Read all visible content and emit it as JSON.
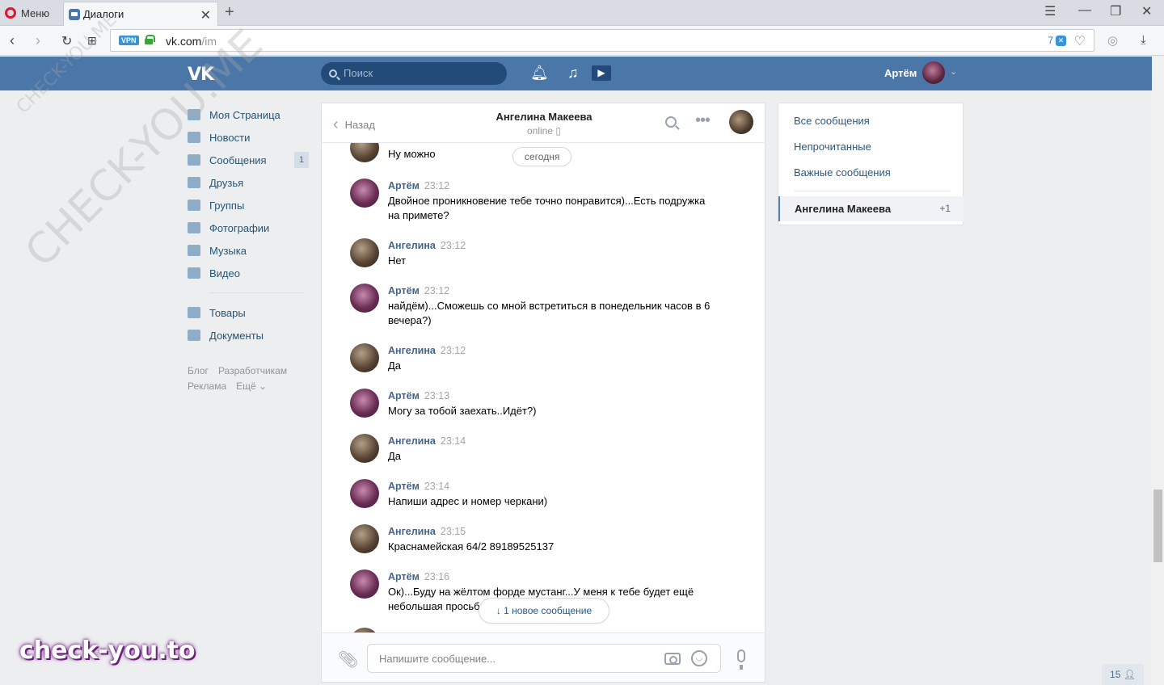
{
  "browser": {
    "menu_label": "Меню",
    "tab_title": "Диалоги",
    "url_host": "vk.com",
    "url_path": "/im",
    "vpn_label": "VPN",
    "adblock_count": "7"
  },
  "header": {
    "logo": "VK",
    "search_placeholder": "Поиск",
    "user_name": "Артём"
  },
  "leftnav": {
    "items": [
      {
        "label": "Моя Страница"
      },
      {
        "label": "Новости"
      },
      {
        "label": "Сообщения",
        "badge": "1"
      },
      {
        "label": "Друзья"
      },
      {
        "label": "Группы"
      },
      {
        "label": "Фотографии"
      },
      {
        "label": "Музыка"
      },
      {
        "label": "Видео"
      }
    ],
    "items2": [
      {
        "label": "Товары"
      },
      {
        "label": "Документы"
      }
    ],
    "footer": [
      "Блог",
      "Разработчикам",
      "Реклама",
      "Ещё ⌄"
    ]
  },
  "chat": {
    "back_label": "Назад",
    "contact_name": "Ангелина Макеева",
    "contact_status": "online",
    "date_divider": "сегодня",
    "partial_message": {
      "text": "Ну можно"
    },
    "messages": [
      {
        "author": "Артём",
        "time": "23:12",
        "text": "Двойное проникновение тебе точно понравится)...Есть подружка на примете?",
        "who": "a"
      },
      {
        "author": "Ангелина",
        "time": "23:12",
        "text": "Нет",
        "who": "g"
      },
      {
        "author": "Артём",
        "time": "23:12",
        "text": "найдём)...Сможешь со мной встретиться в понедельник часов в 6 вечера?)",
        "who": "a"
      },
      {
        "author": "Ангелина",
        "time": "23:12",
        "text": "Да",
        "who": "g"
      },
      {
        "author": "Артём",
        "time": "23:13",
        "text": "Могу за тобой заехать..Идёт?)",
        "who": "a"
      },
      {
        "author": "Ангелина",
        "time": "23:14",
        "text": "Да",
        "who": "g"
      },
      {
        "author": "Артём",
        "time": "23:14",
        "text": "Напиши адрес и номер черкани)",
        "who": "a"
      },
      {
        "author": "Ангелина",
        "time": "23:15",
        "text": "Краснамейская 64/2 89189525137",
        "who": "g"
      },
      {
        "author": "Артём",
        "time": "23:16",
        "text": "Ок)...Буду на жёлтом форде мустанг...У меня к тебе будет ещё небольшая просьба",
        "who": "a"
      }
    ],
    "new_message_pill": "1 новое сообщение",
    "composer_placeholder": "Напишите сообщение..."
  },
  "rightpanel": {
    "filters": [
      "Все сообщения",
      "Непрочитанные",
      "Важные сообщения"
    ],
    "active_dialog": {
      "name": "Ангелина Макеева",
      "count": "+1"
    }
  },
  "online_count": "15",
  "watermark": {
    "text": "CHECK-YOU.ME",
    "brand": "check-you.to"
  }
}
